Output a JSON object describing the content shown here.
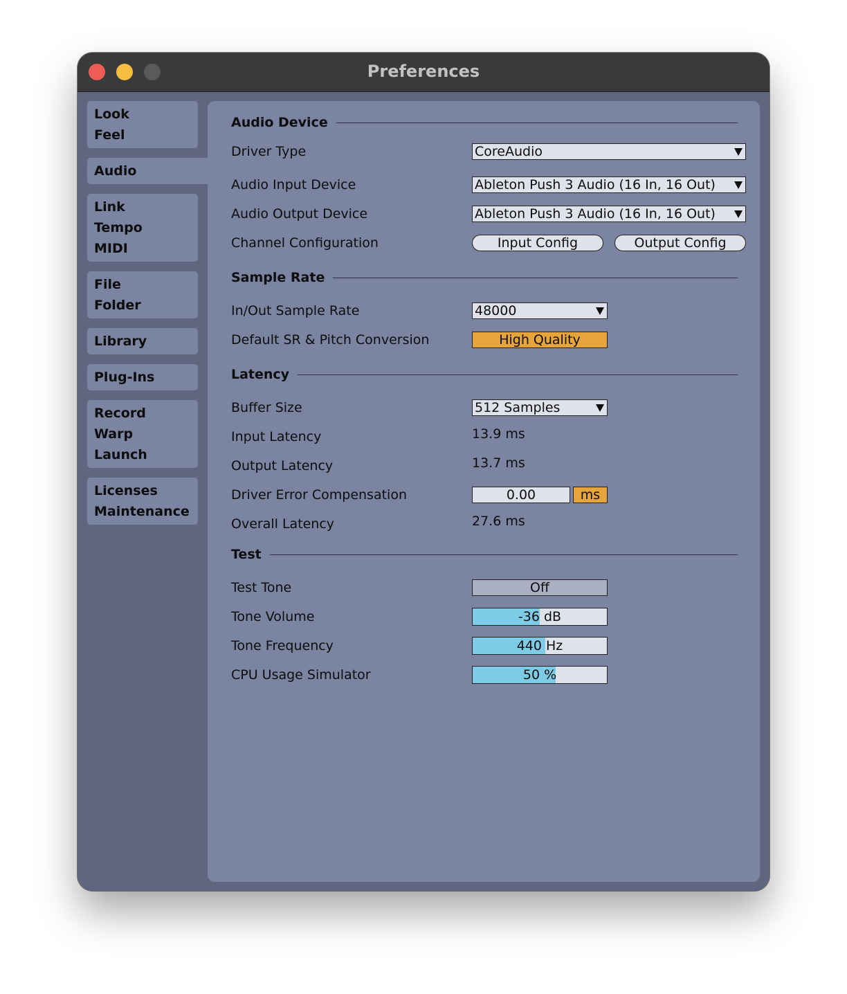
{
  "window": {
    "title": "Preferences"
  },
  "sidebar": {
    "groups": [
      {
        "items": [
          "Look",
          "Feel"
        ]
      },
      {
        "items": [
          "Audio"
        ],
        "active": true
      },
      {
        "items": [
          "Link",
          "Tempo",
          "MIDI"
        ]
      },
      {
        "items": [
          "File",
          "Folder"
        ]
      },
      {
        "items": [
          "Library"
        ]
      },
      {
        "items": [
          "Plug-Ins"
        ]
      },
      {
        "items": [
          "Record",
          "Warp",
          "Launch"
        ]
      },
      {
        "items": [
          "Licenses",
          "Maintenance"
        ]
      }
    ]
  },
  "audio_device": {
    "heading": "Audio Device",
    "driver_type": {
      "label": "Driver Type",
      "value": "CoreAudio"
    },
    "input_device": {
      "label": "Audio Input Device",
      "value": "Ableton Push 3 Audio (16 In, 16 Out)"
    },
    "output_device": {
      "label": "Audio Output Device",
      "value": "Ableton Push 3 Audio (16 In, 16 Out)"
    },
    "channel_config": {
      "label": "Channel Configuration",
      "input_button": "Input Config",
      "output_button": "Output Config"
    }
  },
  "sample_rate": {
    "heading": "Sample Rate",
    "inout": {
      "label": "In/Out Sample Rate",
      "value": "48000"
    },
    "conversion": {
      "label": "Default SR & Pitch Conversion",
      "value": "High Quality"
    }
  },
  "latency": {
    "heading": "Latency",
    "buffer_size": {
      "label": "Buffer Size",
      "value": "512 Samples"
    },
    "input_latency": {
      "label": "Input Latency",
      "value": "13.9 ms"
    },
    "output_latency": {
      "label": "Output Latency",
      "value": "13.7 ms"
    },
    "driver_error": {
      "label": "Driver Error Compensation",
      "value": "0.00",
      "unit": "ms"
    },
    "overall": {
      "label": "Overall Latency",
      "value": "27.6 ms"
    }
  },
  "test": {
    "heading": "Test",
    "test_tone": {
      "label": "Test Tone",
      "value": "Off"
    },
    "tone_volume": {
      "label": "Tone Volume",
      "value": "-36 dB",
      "level": 0.5
    },
    "tone_frequency": {
      "label": "Tone Frequency",
      "value": "440 Hz",
      "level": 0.54
    },
    "cpu_simulator": {
      "label": "CPU Usage Simulator",
      "value": "50 %",
      "level": 0.62
    }
  },
  "colors": {
    "accent_orange": "#e5a53c",
    "slider_fill": "#7ecbe5",
    "panel_bg": "#7b84a0",
    "window_bg": "#5f6680"
  }
}
